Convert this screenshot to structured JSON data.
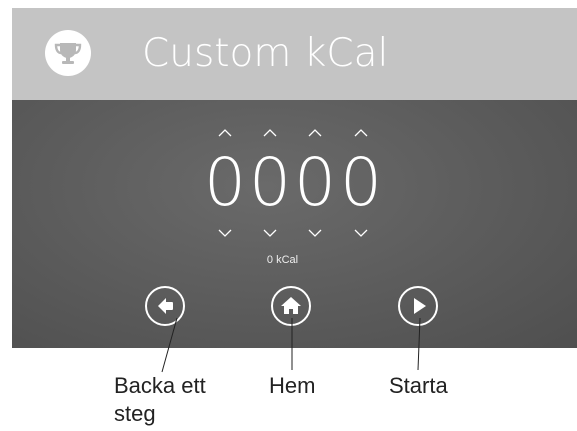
{
  "header": {
    "title": "Custom kCal",
    "icon": "trophy-icon",
    "background": "#c4c4c4"
  },
  "input": {
    "digits": [
      "0",
      "0",
      "0",
      "0"
    ],
    "unit_readout": "0 kCal",
    "increment_icon": "chevron-up-icon",
    "decrement_icon": "chevron-down-icon"
  },
  "buttons": [
    {
      "name": "back-button",
      "icon": "arrow-left-icon"
    },
    {
      "name": "home-button",
      "icon": "home-icon"
    },
    {
      "name": "start-button",
      "icon": "play-icon"
    }
  ],
  "callouts": {
    "back": "Backa ett steg",
    "home": "Hem",
    "start": "Starta"
  },
  "colors": {
    "panel": "#5e5e5e",
    "text": "#ffffff",
    "callout_text": "#222222"
  }
}
